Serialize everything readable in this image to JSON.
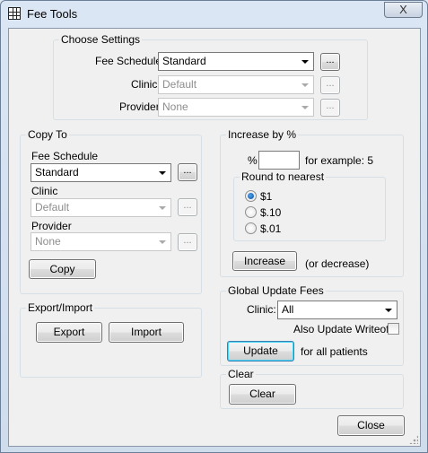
{
  "window": {
    "title": "Fee Tools",
    "close_glyph": "X"
  },
  "choose_settings": {
    "legend": "Choose Settings",
    "fee_schedule_label": "Fee Schedule",
    "fee_schedule_value": "Standard",
    "clinic_label": "Clinic",
    "clinic_value": "Default",
    "provider_label": "Provider",
    "provider_value": "None",
    "ellipsis": "..."
  },
  "copy_to": {
    "legend": "Copy To",
    "fee_schedule_label": "Fee Schedule",
    "fee_schedule_value": "Standard",
    "clinic_label": "Clinic",
    "clinic_value": "Default",
    "provider_label": "Provider",
    "provider_value": "None",
    "ellipsis": "...",
    "copy_button": "Copy"
  },
  "export_import": {
    "legend": "Export/Import",
    "export_button": "Export",
    "import_button": "Import"
  },
  "increase_by": {
    "legend": "Increase by %",
    "percent_label": "%",
    "percent_value": "",
    "example_text": "for example: 5",
    "round_legend": "Round to nearest",
    "options": [
      "$1",
      "$.10",
      "$.01"
    ],
    "selected_option": "$1",
    "increase_button": "Increase",
    "decrease_note": "(or decrease)"
  },
  "global_update": {
    "legend": "Global Update Fees",
    "clinic_label": "Clinic:",
    "clinic_value": "All",
    "writeoffs_label": "Also Update Writeoffs",
    "writeoffs_checked": false,
    "update_button": "Update",
    "note": "for all patients"
  },
  "clear": {
    "legend": "Clear",
    "clear_button": "Clear"
  },
  "footer": {
    "close_button": "Close"
  },
  "icons": [
    "grid-table-icon",
    "close-icon",
    "dropdown-arrow-icon",
    "resize-grip-icon"
  ]
}
